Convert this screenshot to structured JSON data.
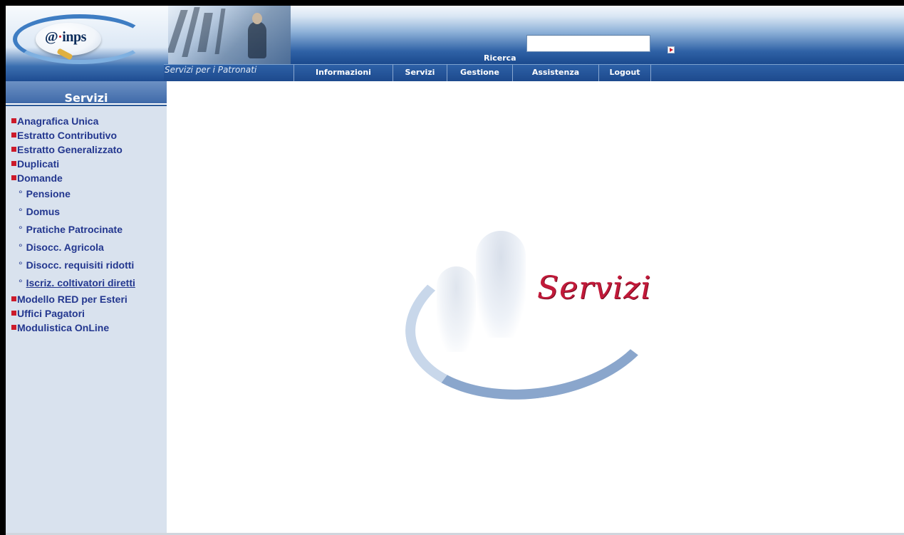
{
  "header": {
    "logo_text_e": "@",
    "logo_text_inps": "inps",
    "tagline": "Servizi per i Patronati",
    "search_label": "Ricerca",
    "search_value": "",
    "search_placeholder": ""
  },
  "nav": {
    "items": [
      {
        "label": "Informazioni"
      },
      {
        "label": "Servizi"
      },
      {
        "label": "Gestione"
      },
      {
        "label": "Assistenza"
      },
      {
        "label": "Logout"
      }
    ]
  },
  "sidebar": {
    "title": "Servizi",
    "items": [
      {
        "label": "Anagrafica Unica"
      },
      {
        "label": "Estratto Contributivo"
      },
      {
        "label": "Estratto Generalizzato"
      },
      {
        "label": "Duplicati"
      },
      {
        "label": "Domande"
      },
      {
        "label": "Pensione"
      },
      {
        "label": "Domus"
      },
      {
        "label": "Pratiche Patrocinate"
      },
      {
        "label": "Disocc. Agricola"
      },
      {
        "label": "Disocc. requisiti ridotti"
      },
      {
        "label": "Iscriz. coltivatori diretti"
      },
      {
        "label": "Modello RED per Esteri"
      },
      {
        "label": "Uffici Pagatori"
      },
      {
        "label": "Modulistica OnLine"
      }
    ]
  },
  "main": {
    "splash_word": "Servizi"
  },
  "colors": {
    "nav_blue": "#1d4a8d",
    "sidebar_bg": "#d9e2ee",
    "link_blue": "#23378f",
    "bullet_red": "#cc1a2a",
    "splash_red": "#c21a3a"
  }
}
